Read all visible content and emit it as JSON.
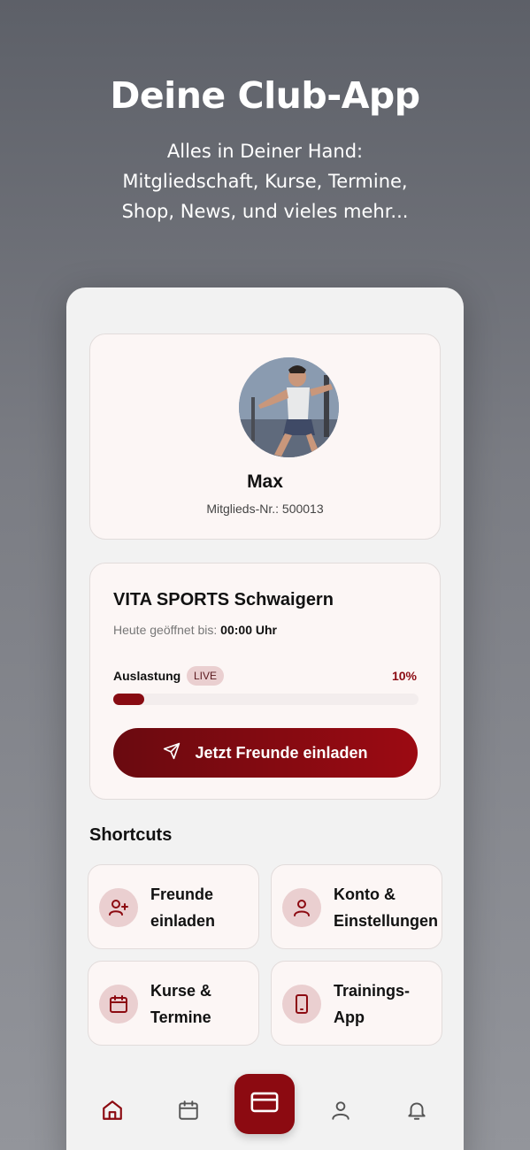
{
  "hero": {
    "title": "Deine Club-App",
    "subtitle_lines": [
      "Alles in Deiner Hand:",
      "Mitgliedschaft, Kurse, Termine,",
      "Shop, News, und vieles mehr..."
    ]
  },
  "profile": {
    "name": "Max",
    "member_number": "Mitglieds-Nr.: 500013"
  },
  "club": {
    "name": "VITA SPORTS Schwaigern",
    "open_label": "Heute geöffnet bis:",
    "open_value": "00:00 Uhr",
    "load_label": "Auslastung",
    "live_badge": "LIVE",
    "load_percent_text": "10%",
    "load_fraction": 0.1,
    "invite_button": "Jetzt Freunde einladen"
  },
  "shortcuts": {
    "title": "Shortcuts",
    "items": [
      {
        "line1": "Freunde",
        "line2": "einladen",
        "icon": "user-plus-icon"
      },
      {
        "line1": "Konto &",
        "line2": "Einstellungen",
        "icon": "user-icon"
      },
      {
        "line1": "Kurse &",
        "line2": "Termine",
        "icon": "calendar-icon"
      },
      {
        "line1": "Trainings-",
        "line2": "App",
        "icon": "smartphone-icon"
      }
    ]
  },
  "nav": {
    "items": [
      "home-icon",
      "calendar-icon",
      "card-icon",
      "user-icon",
      "bell-icon"
    ],
    "active": "home-icon"
  },
  "colors": {
    "accent": "#8c0a11",
    "card_bg": "#fcf6f5",
    "icon_bg": "#eacfd0"
  }
}
